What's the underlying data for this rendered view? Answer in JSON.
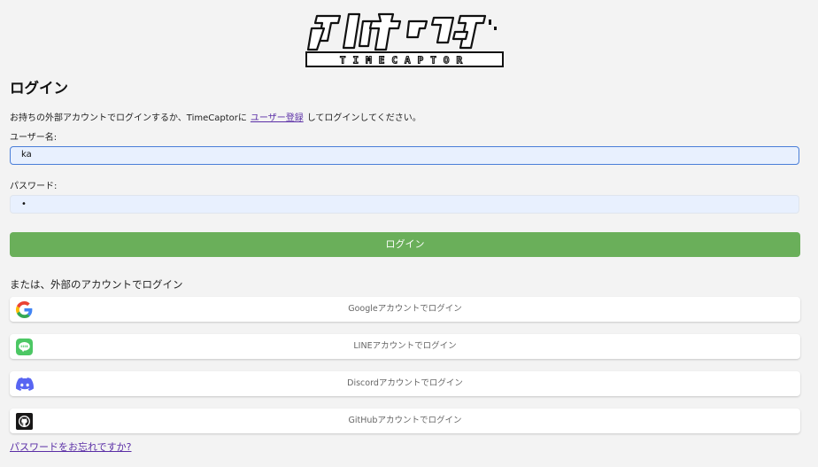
{
  "logo": {
    "jp_text": "タイムキャプター",
    "en_text": "TIMECAPTOR"
  },
  "title": "ログイン",
  "intro": {
    "before": "お持ちの外部アカウントでログインするか、TimeCaptorに",
    "link": "ユーザー登録",
    "after": "してログインしてください。"
  },
  "username": {
    "label": "ユーザー名:",
    "value": "ka"
  },
  "password": {
    "label": "パスワード:",
    "value": "•"
  },
  "submit_label": "ログイン",
  "external": {
    "heading": "または、外部のアカウントでログイン",
    "providers": [
      {
        "name": "google",
        "label": "Googleアカウントでログイン",
        "icon": "google-icon"
      },
      {
        "name": "line",
        "label": "LINEアカウントでログイン",
        "icon": "line-icon",
        "color": "#4cc764"
      },
      {
        "name": "discord",
        "label": "Discordアカウントでログイン",
        "icon": "discord-icon",
        "color": "#5865f2"
      },
      {
        "name": "github",
        "label": "GitHubアカウントでログイン",
        "icon": "github-icon",
        "color": "#181717"
      }
    ]
  },
  "forgot_password": "パスワードをお忘れですか?",
  "colors": {
    "accent_green": "#6aaf5a",
    "link_purple": "#5a2ea6",
    "field_bg": "#e8f0fe",
    "focus_border": "#4a7ed8"
  }
}
